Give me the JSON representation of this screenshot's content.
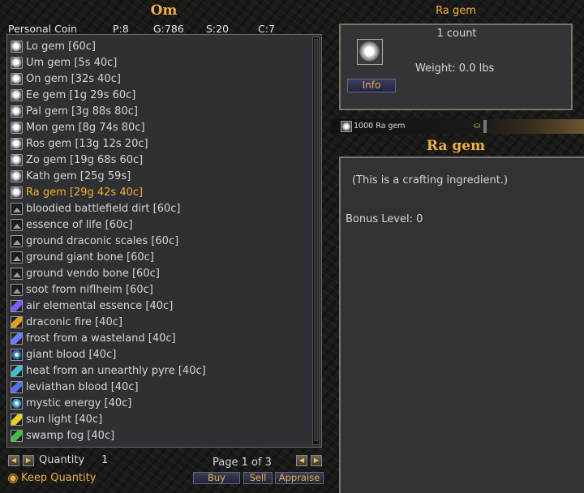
{
  "vendor": {
    "title": "Om",
    "coins": {
      "label": "Personal Coin",
      "p": "P:8",
      "g": "G:786",
      "s": "S:20",
      "c": "C:7"
    },
    "items": [
      {
        "label": "Lo gem [60c]",
        "icon": "gem-icon"
      },
      {
        "label": "Um gem [5s 40c]",
        "icon": "gem-icon"
      },
      {
        "label": "On gem [32s 40c]",
        "icon": "gem-icon"
      },
      {
        "label": "Ee gem [1g 29s 60c]",
        "icon": "gem-icon"
      },
      {
        "label": "Pal gem [3g 88s 80c]",
        "icon": "gem-icon"
      },
      {
        "label": "Mon gem [8g 74s 80c]",
        "icon": "gem-icon"
      },
      {
        "label": "Ros gem [13g 12s 20c]",
        "icon": "gem-icon"
      },
      {
        "label": "Zo gem [19g 68s 60c]",
        "icon": "gem-icon"
      },
      {
        "label": "Kath gem [25g 59s]",
        "icon": "gem-icon"
      },
      {
        "label": "Ra gem [29g 42s 40c]",
        "icon": "gem-icon",
        "selected": true
      },
      {
        "label": "bloodied battlefield dirt [60c]",
        "icon": "dust-pile-icon"
      },
      {
        "label": "essence of life [60c]",
        "icon": "dust-pile-icon"
      },
      {
        "label": "ground draconic scales [60c]",
        "icon": "dust-pile-icon"
      },
      {
        "label": "ground giant bone [60c]",
        "icon": "dust-pile-icon"
      },
      {
        "label": "ground vendo bone [60c]",
        "icon": "dust-pile-icon"
      },
      {
        "label": "soot from niflheim [60c]",
        "icon": "dust-pile-icon"
      },
      {
        "label": "air elemental essence [40c]",
        "icon": "vial-icon",
        "color": "#7a5cff"
      },
      {
        "label": "draconic fire [40c]",
        "icon": "vial-icon",
        "color": "#e0a020"
      },
      {
        "label": "frost from a wasteland [40c]",
        "icon": "vial-icon",
        "color": "#6a7cff"
      },
      {
        "label": "giant blood [40c]",
        "icon": "orb-icon",
        "color": "#3a78b0"
      },
      {
        "label": "heat from an unearthly pyre [40c]",
        "icon": "vial-icon",
        "color": "#40c0d0"
      },
      {
        "label": "leviathan blood [40c]",
        "icon": "vial-icon",
        "color": "#5a6cf0"
      },
      {
        "label": "mystic energy [40c]",
        "icon": "orb-icon",
        "color": "#4a9ad0"
      },
      {
        "label": "sun light [40c]",
        "icon": "vial-icon",
        "color": "#e8d020"
      },
      {
        "label": "swamp fog [40c]",
        "icon": "vial-icon",
        "color": "#40c040"
      }
    ],
    "quantity_label": "Quantity",
    "quantity_value": "1",
    "page_label": "Page 1 of 3",
    "keep_quantity_label": "Keep Quantity",
    "buy_label": "Buy",
    "sell_label": "Sell",
    "appraise_label": "Appraise"
  },
  "item_info": {
    "title": "Ra gem",
    "count_text": "1 count",
    "weight_text": "Weight: 0.0 lbs",
    "info_button_label": "Info",
    "stack_text": "1000 Ra gem",
    "section_title": "Ra gem",
    "description": "(This is a crafting ingredient.)",
    "bonus_text": "Bonus Level: 0"
  },
  "colors": {
    "accent": "#f2b13c",
    "selected_text": "#f0b132",
    "panel_bg": "#2f3033"
  }
}
